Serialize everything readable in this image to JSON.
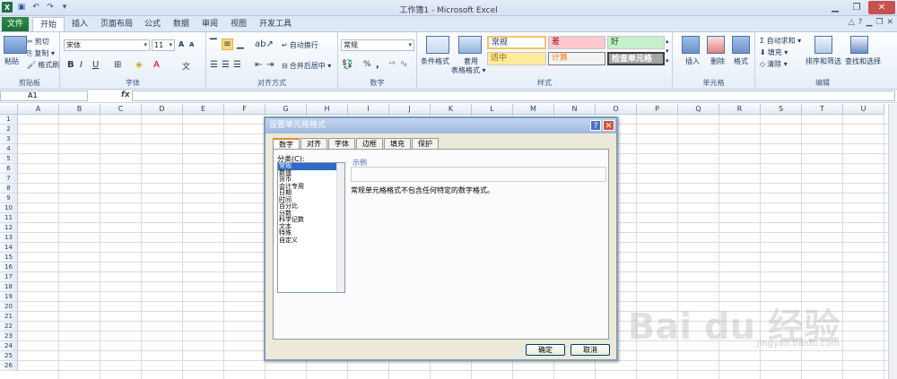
{
  "window": {
    "title": "工作簿1 - Microsoft Excel"
  },
  "tabs": {
    "file": "文件",
    "items": [
      "开始",
      "插入",
      "页面布局",
      "公式",
      "数据",
      "审阅",
      "视图",
      "开发工具"
    ]
  },
  "ribbon": {
    "clipboard": {
      "label": "剪贴板",
      "paste": "粘贴",
      "cut": "剪切",
      "copy": "复制 ▾",
      "format_painter": "格式刷"
    },
    "font": {
      "label": "字体",
      "name": "宋体",
      "size": "11",
      "grow": "A",
      "shrink": "A",
      "bold": "B",
      "italic": "I",
      "underline": "U",
      "wen": "文"
    },
    "alignment": {
      "label": "对齐方式",
      "wrap": "自动换行",
      "merge": "合并后居中 ▾"
    },
    "number": {
      "label": "数字",
      "format": "常规",
      "percent": "%",
      "comma": ","
    },
    "styles": {
      "label": "样式",
      "conditional": "条件格式",
      "table": "套用",
      "table2": "表格格式 ▾",
      "normal": "常规",
      "bad": "差",
      "good": "好",
      "neutral": "适中",
      "calc": "计算",
      "check": "检查单元格"
    },
    "cells": {
      "label": "单元格",
      "insert": "插入",
      "delete": "删除",
      "format": "格式"
    },
    "editing": {
      "label": "编辑",
      "autosum": "Σ 自动求和 ▾",
      "fill": "填充 ▾",
      "clear": "清除 ▾",
      "sort": "排序和筛选",
      "find": "查找和选择"
    }
  },
  "formula_bar": {
    "cell_ref": "A1",
    "fx": "fx"
  },
  "grid": {
    "columns": [
      "A",
      "B",
      "C",
      "D",
      "E",
      "F",
      "G",
      "H",
      "I",
      "J",
      "K",
      "L",
      "M",
      "N",
      "O",
      "P",
      "Q",
      "R",
      "S",
      "T",
      "U"
    ],
    "rows": [
      "1",
      "2",
      "3",
      "4",
      "5",
      "6",
      "7",
      "8",
      "9",
      "10",
      "11",
      "12",
      "13",
      "14",
      "15",
      "16",
      "17",
      "18",
      "19",
      "20",
      "21",
      "22",
      "23",
      "24",
      "25",
      "26"
    ]
  },
  "dialog": {
    "title": "设置单元格格式",
    "tabs": [
      "数字",
      "对齐",
      "字体",
      "边框",
      "填充",
      "保护"
    ],
    "category_label": "分类(C):",
    "categories": [
      "常规",
      "数值",
      "货币",
      "会计专用",
      "日期",
      "时间",
      "百分比",
      "分数",
      "科学记数",
      "文本",
      "特殊",
      "自定义"
    ],
    "sample_label": "示例",
    "description": "常规单元格格式不包含任何特定的数字格式。",
    "ok": "确定",
    "cancel": "取消"
  },
  "watermark": {
    "brand": "Bai du 经验",
    "url": "jingyan.baidu.com"
  }
}
